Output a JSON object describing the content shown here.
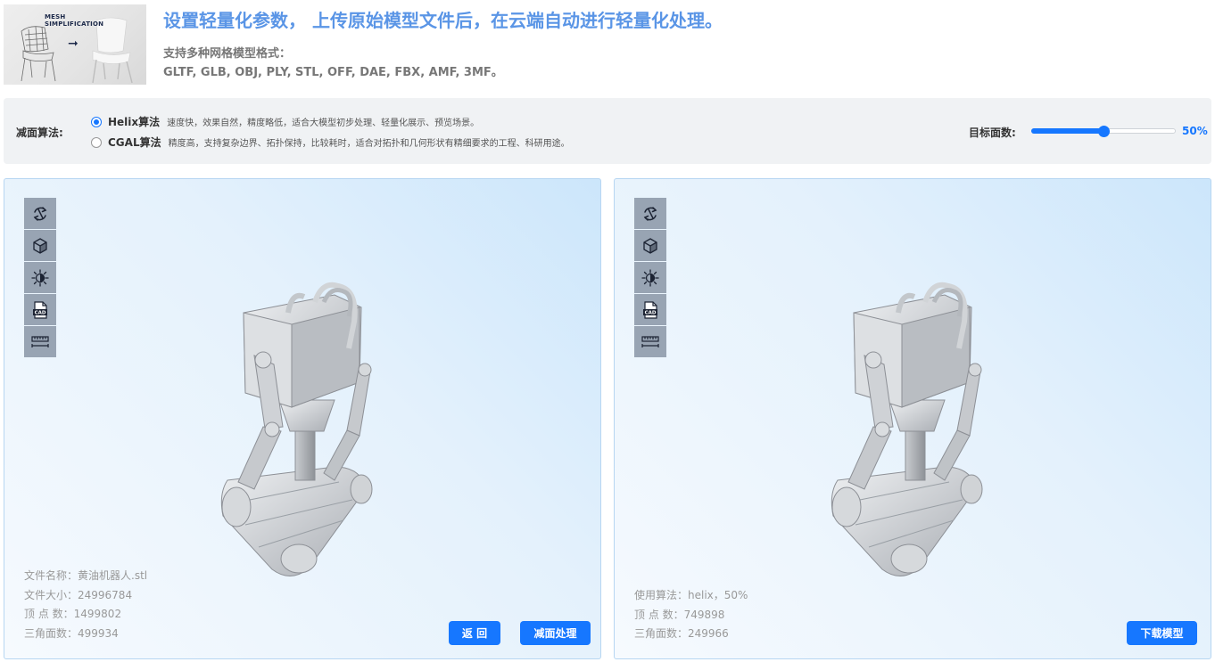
{
  "header": {
    "thumbnail_title_line1": "MESH",
    "thumbnail_title_line2": "SIMPLIFICATION",
    "headline": "设置轻量化参数， 上传原始模型文件后，在云端自动进行轻量化处理。",
    "formats_label": "支持多种网格模型格式：",
    "formats_list": "GLTF, GLB, OBJ, PLY, STL, OFF, DAE, FBX, AMF, 3MF。"
  },
  "settings": {
    "algorithm_label": "减面算法:",
    "options": [
      {
        "name": "Helix算法",
        "description": "速度快，效果自然，精度略低，适合大模型初步处理、轻量化展示、预览场景。",
        "selected": true
      },
      {
        "name": "CGAL算法",
        "description": "精度高，支持复杂边界、拓扑保持，比较耗时，适合对拓扑和几何形状有精细要求的工程、科研用途。",
        "selected": false
      }
    ],
    "target_label": "目标面数:",
    "target_percent": 50,
    "target_value_text": "50%"
  },
  "toolbar_icons": [
    "rotate-icon",
    "cube-view-icon",
    "lighting-icon",
    "cad-file-icon",
    "measure-icon"
  ],
  "original_panel": {
    "info": [
      "文件名称：黄油机器人.stl",
      "文件大小：24996784",
      "顶 点 数：1499802",
      "三角面数：499934"
    ],
    "back_button": "返 回",
    "reduce_button": "减面处理"
  },
  "result_panel": {
    "info": [
      "使用算法：helix，50%",
      "顶 点 数：749898",
      "三角面数：249966"
    ],
    "download_button": "下载模型"
  },
  "colors": {
    "accent": "#1677ff",
    "headline": "#5a95e6",
    "toolbar": "#98a4b3",
    "panel_border": "#b7d6f2"
  }
}
